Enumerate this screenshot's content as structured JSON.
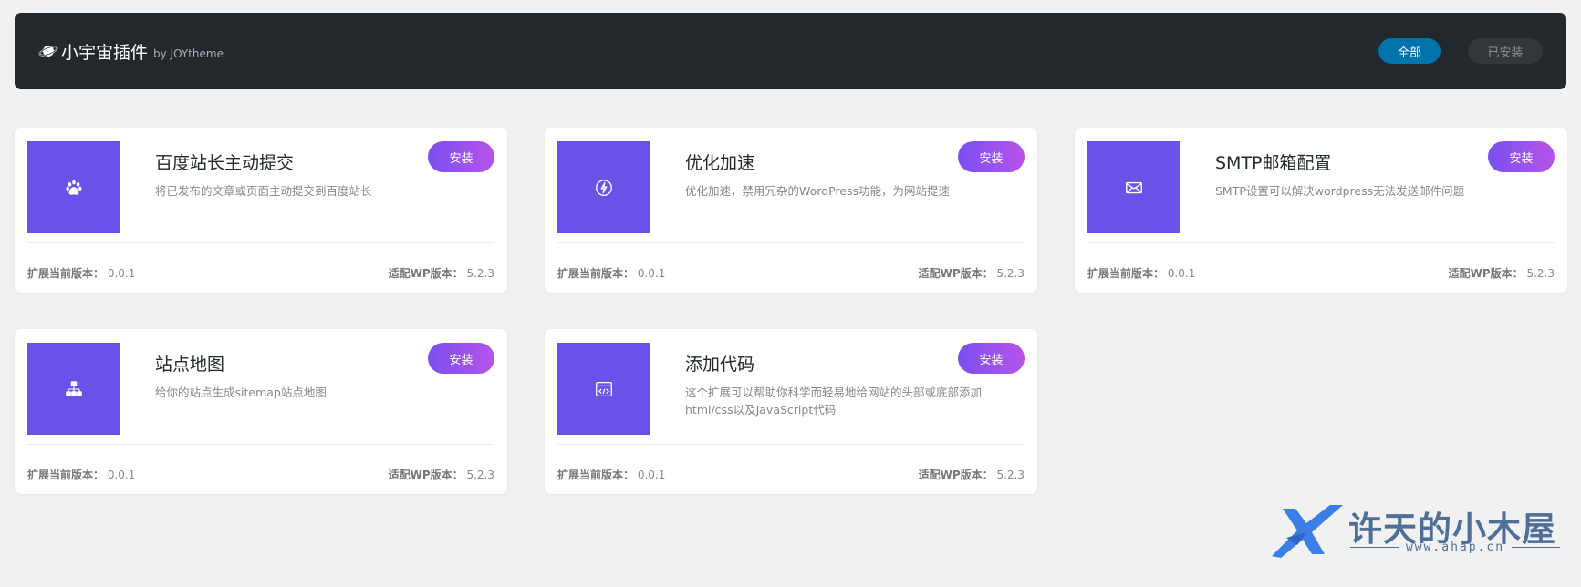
{
  "header": {
    "brand_name": "小宇宙插件",
    "brand_by": "by JOYtheme",
    "filters": [
      {
        "label": "全部",
        "active": true
      },
      {
        "label": "已安装",
        "active": false
      }
    ]
  },
  "labels": {
    "install": "安装",
    "current_version": "扩展当前版本：",
    "wp_version": "适配WP版本："
  },
  "plugins": [
    {
      "title": "百度站长主动提交",
      "desc": "将已发布的文章或页面主动提交到百度站长",
      "icon": "paw-icon",
      "version": "0.0.1",
      "wp": "5.2.3"
    },
    {
      "title": "优化加速",
      "desc": "优化加速，禁用冗杂的WordPress功能，为网站提速",
      "icon": "lightning-icon",
      "version": "0.0.1",
      "wp": "5.2.3"
    },
    {
      "title": "SMTP邮箱配置",
      "desc": "SMTP设置可以解决wordpress无法发送邮件问题",
      "icon": "mail-icon",
      "version": "0.0.1",
      "wp": "5.2.3"
    },
    {
      "title": "站点地图",
      "desc": "给你的站点生成sitemap站点地图",
      "icon": "sitemap-icon",
      "version": "0.0.1",
      "wp": "5.2.3"
    },
    {
      "title": "添加代码",
      "desc": "这个扩展可以帮助你科学而轻易地给网站的头部或底部添加html/css以及JavaScript代码",
      "icon": "code-icon",
      "version": "0.0.1",
      "wp": "5.2.3"
    }
  ],
  "watermark": {
    "text": "许天的小木屋",
    "url": "www.ahap.cn"
  },
  "colors": {
    "topbar": "#23282d",
    "accent": "#0073aa",
    "thumb": "#6a51e8",
    "install_gradient_start": "#7a4ff0",
    "install_gradient_end": "#b654e8"
  }
}
